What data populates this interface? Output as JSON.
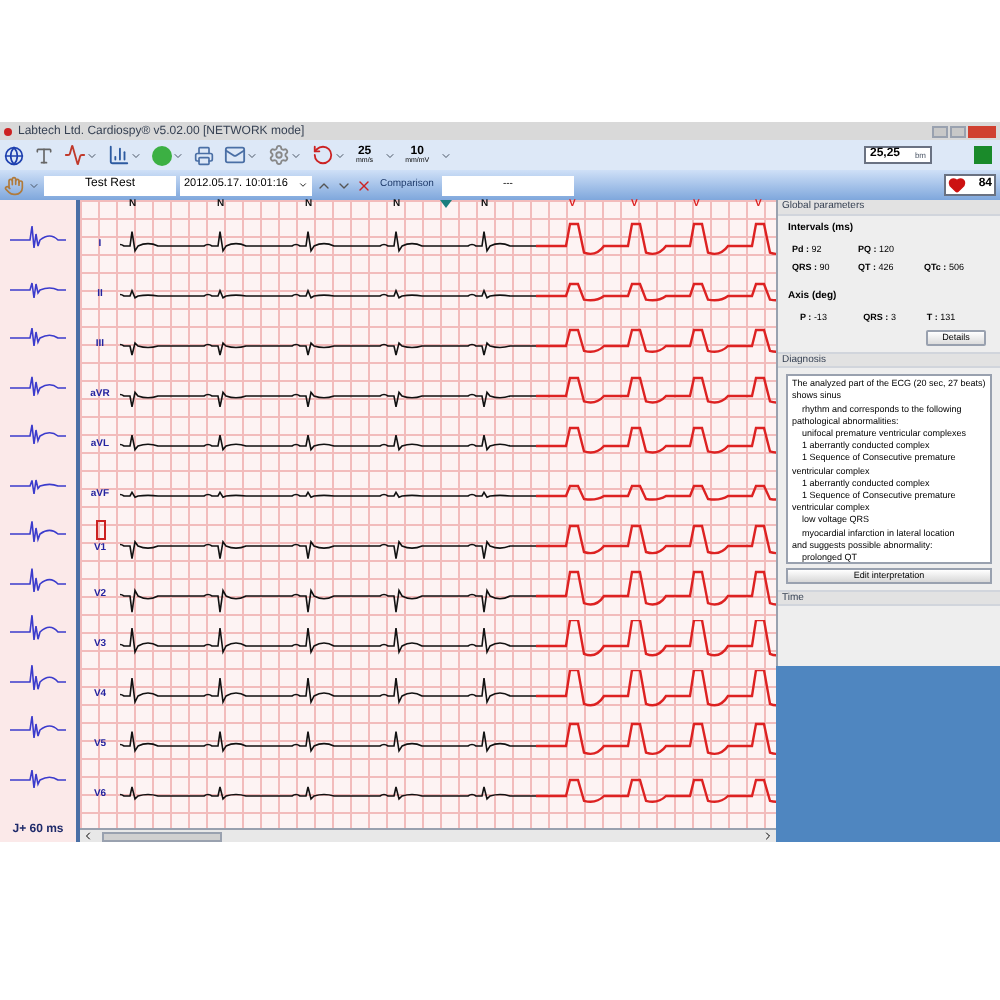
{
  "window": {
    "title": "Labtech Ltd. Cardiospy® v5.02.00 [NETWORK mode]"
  },
  "toolbar": {
    "paper_speed": {
      "value": "25",
      "unit": "mm/s"
    },
    "gain": {
      "value": "10",
      "unit": "mm/mV"
    },
    "reading": {
      "value": "25,25",
      "unit": "bm"
    }
  },
  "record_bar": {
    "test": "Test Rest",
    "date": "2012.05.17. 10:01:16",
    "comparison": "Comparison",
    "comparison_value": "---",
    "heart_rate": "84"
  },
  "beats": [
    {
      "kind": "N",
      "label": "N"
    },
    {
      "kind": "N",
      "label": "N"
    },
    {
      "kind": "N",
      "label": "N"
    },
    {
      "kind": "N",
      "label": "N"
    },
    {
      "kind": "N",
      "label": "N"
    },
    {
      "kind": "V",
      "label": "V"
    },
    {
      "kind": "V",
      "label": "V"
    },
    {
      "kind": "V",
      "label": "V"
    },
    {
      "kind": "V",
      "label": "V"
    }
  ],
  "leads": [
    {
      "name": "I",
      "marked": false
    },
    {
      "name": "II",
      "marked": false
    },
    {
      "name": "III",
      "marked": false
    },
    {
      "name": "aVR",
      "marked": false
    },
    {
      "name": "aVL",
      "marked": false
    },
    {
      "name": "aVF",
      "marked": false
    },
    {
      "name": "V1",
      "marked": true
    },
    {
      "name": "V2",
      "marked": false
    },
    {
      "name": "V3",
      "marked": false
    },
    {
      "name": "V4",
      "marked": false
    },
    {
      "name": "V5",
      "marked": false
    },
    {
      "name": "V6",
      "marked": false
    }
  ],
  "j_point": "J+ 60 ms",
  "global_parameters": {
    "title": "Global parameters",
    "intervals_title": "Intervals (ms)",
    "intervals": [
      {
        "label": "Pd :",
        "value": "92"
      },
      {
        "label": "PQ :",
        "value": "120"
      },
      {
        "label": "QRS :",
        "value": "90"
      },
      {
        "label": "QT :",
        "value": "426"
      },
      {
        "label": "QTc :",
        "value": "506"
      }
    ],
    "axis_title": "Axis (deg)",
    "axis": [
      {
        "label": "P :",
        "value": "-13"
      },
      {
        "label": "QRS :",
        "value": "3"
      },
      {
        "label": "T :",
        "value": "131"
      }
    ],
    "details_button": "Details"
  },
  "diagnosis": {
    "title": "Diagnosis",
    "lines": [
      {
        "kind": "text",
        "text": "The analyzed part of the ECG (20 sec, 27 beats)"
      },
      {
        "kind": "text",
        "text": "shows sinus"
      },
      {
        "kind": "item",
        "text": "rhythm and corresponds to the following"
      },
      {
        "kind": "text",
        "text": "pathological abnormalities:"
      },
      {
        "kind": "item",
        "text": "unifocal premature ventricular complexes"
      },
      {
        "kind": "item",
        "text": "1 aberrantly conducted complex"
      },
      {
        "kind": "item",
        "text": "1 Sequence of Consecutive premature"
      },
      {
        "kind": "text",
        "text": "ventricular complex"
      },
      {
        "kind": "item",
        "text": "1 aberrantly conducted complex"
      },
      {
        "kind": "item",
        "text": "1 Sequence of Consecutive premature"
      },
      {
        "kind": "text",
        "text": "ventricular complex"
      },
      {
        "kind": "item",
        "text": "low voltage QRS"
      },
      {
        "kind": "item",
        "text": "myocardial infarction in lateral location"
      },
      {
        "kind": "text",
        "text": "and suggests possible abnormality:"
      },
      {
        "kind": "item",
        "text": "prolonged QT"
      }
    ],
    "edit_button": "Edit interpretation"
  },
  "time": {
    "title": "Time"
  }
}
